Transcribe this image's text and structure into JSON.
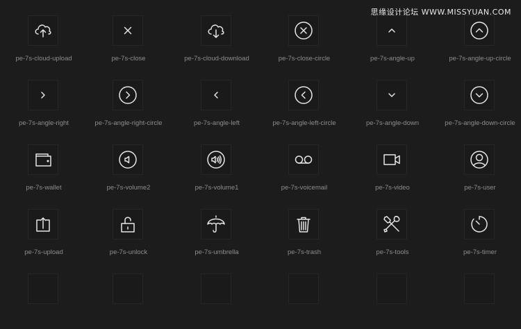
{
  "watermark": "思缘设计论坛 WWW.MISSYUAN.COM",
  "icons": [
    {
      "label": "pe-7s-cloud-upload",
      "icon": "cloud-upload-icon"
    },
    {
      "label": "pe-7s-close",
      "icon": "close-icon"
    },
    {
      "label": "pe-7s-cloud-download",
      "icon": "cloud-download-icon"
    },
    {
      "label": "pe-7s-close-circle",
      "icon": "close-circle-icon"
    },
    {
      "label": "pe-7s-angle-up",
      "icon": "angle-up-icon"
    },
    {
      "label": "pe-7s-angle-up-circle",
      "icon": "angle-up-circle-icon"
    },
    {
      "label": "pe-7s-angle-right",
      "icon": "angle-right-icon"
    },
    {
      "label": "pe-7s-angle-right-circle",
      "icon": "angle-right-circle-icon"
    },
    {
      "label": "pe-7s-angle-left",
      "icon": "angle-left-icon"
    },
    {
      "label": "pe-7s-angle-left-circle",
      "icon": "angle-left-circle-icon"
    },
    {
      "label": "pe-7s-angle-down",
      "icon": "angle-down-icon"
    },
    {
      "label": "pe-7s-angle-down-circle",
      "icon": "angle-down-circle-icon"
    },
    {
      "label": "pe-7s-wallet",
      "icon": "wallet-icon"
    },
    {
      "label": "pe-7s-volume2",
      "icon": "volume2-icon"
    },
    {
      "label": "pe-7s-volume1",
      "icon": "volume1-icon"
    },
    {
      "label": "pe-7s-voicemail",
      "icon": "voicemail-icon"
    },
    {
      "label": "pe-7s-video",
      "icon": "video-icon"
    },
    {
      "label": "pe-7s-user",
      "icon": "user-icon"
    },
    {
      "label": "pe-7s-upload",
      "icon": "upload-icon"
    },
    {
      "label": "pe-7s-unlock",
      "icon": "unlock-icon"
    },
    {
      "label": "pe-7s-umbrella",
      "icon": "umbrella-icon"
    },
    {
      "label": "pe-7s-trash",
      "icon": "trash-icon"
    },
    {
      "label": "pe-7s-tools",
      "icon": "tools-icon"
    },
    {
      "label": "pe-7s-timer",
      "icon": "timer-icon"
    }
  ],
  "colors": {
    "background": "#1c1c1c",
    "tile": "#1a1a1a",
    "icon": "#e6e6e6",
    "label": "#8d8d8d"
  }
}
